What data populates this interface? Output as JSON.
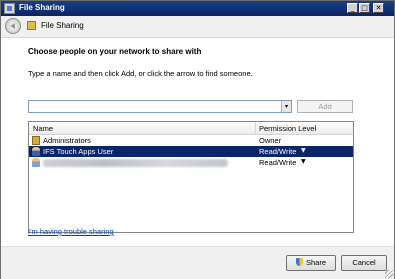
{
  "window": {
    "title": "File Sharing",
    "controls": {
      "minimize": "_",
      "maximize": "□",
      "close": "✕"
    }
  },
  "nav": {
    "title": "File Sharing",
    "back_icon": "back-arrow-icon"
  },
  "main": {
    "heading": "Choose people on your network to share with",
    "instructions": "Type a name and then click Add, or click the arrow to find someone.",
    "name_input": {
      "value": "",
      "placeholder": ""
    },
    "dropdown_arrow": "▾",
    "add_label": "Add",
    "columns": {
      "name": "Name",
      "permission": "Permission Level"
    },
    "rows": [
      {
        "name": "Administrators",
        "permission": "Owner",
        "icon": "group-icon",
        "has_dropdown": false,
        "selected": false
      },
      {
        "name": "IFS Touch Apps User",
        "permission": "Read/Write",
        "icon": "user-icon",
        "has_dropdown": true,
        "selected": true
      },
      {
        "name": "",
        "permission": "Read/Write",
        "icon": "user-icon",
        "has_dropdown": true,
        "selected": false,
        "redacted": true
      }
    ],
    "row_dropdown_glyph": "▼",
    "trouble_link": "I'm having trouble sharing"
  },
  "footer": {
    "share_label": "Share",
    "cancel_label": "Cancel"
  },
  "colors": {
    "title_bar": "#0b2463",
    "selection": "#0a246a",
    "link": "#0645ad"
  }
}
